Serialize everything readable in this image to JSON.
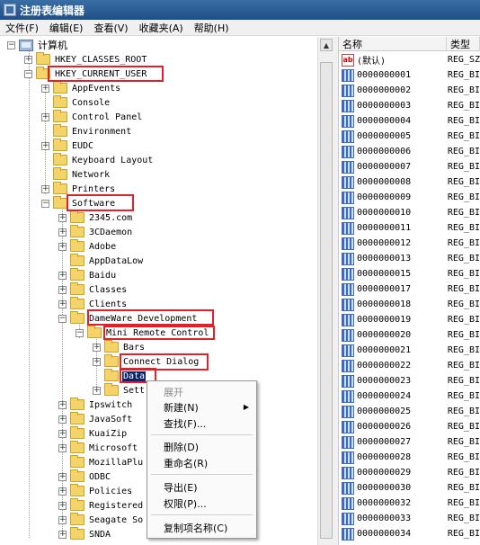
{
  "window": {
    "title": "注册表编辑器"
  },
  "menu": [
    "文件(F)",
    "编辑(E)",
    "查看(V)",
    "收藏夹(A)",
    "帮助(H)"
  ],
  "tree": {
    "root": "计算机",
    "hives": [
      "HKEY_CLASSES_ROOT",
      "HKEY_CURRENT_USER"
    ],
    "hkcu_children": [
      "AppEvents",
      "Console",
      "Control Panel",
      "Environment",
      "EUDC",
      "Keyboard Layout",
      "Network",
      "Printers",
      "Software"
    ],
    "software_children": [
      "2345.com",
      "3CDaemon",
      "Adobe",
      "AppDataLow",
      "Baidu",
      "Classes",
      "Clients",
      "DameWare Development"
    ],
    "dameware_children": [
      "Mini Remote Control"
    ],
    "mrc_children": [
      "Bars",
      "Connect Dialog",
      "Data",
      "Sett"
    ],
    "software_children_2": [
      "Ipswitch",
      "JavaSoft",
      "KuaiZip",
      "Microsoft",
      "MozillaPlu",
      "ODBC",
      "Policies",
      "Registered",
      "Seagate So",
      "SNDA"
    ]
  },
  "list": {
    "headers": [
      "名称",
      "类型"
    ],
    "rows": [
      {
        "name": "(默认)",
        "type": "REG_SZ",
        "icon": "string-value-icon"
      },
      {
        "name": "0000000001",
        "type": "REG_BI",
        "icon": "binary-value-icon"
      },
      {
        "name": "0000000002",
        "type": "REG_BI",
        "icon": "binary-value-icon"
      },
      {
        "name": "0000000003",
        "type": "REG_BI",
        "icon": "binary-value-icon"
      },
      {
        "name": "0000000004",
        "type": "REG_BI",
        "icon": "binary-value-icon"
      },
      {
        "name": "0000000005",
        "type": "REG_BI",
        "icon": "binary-value-icon"
      },
      {
        "name": "0000000006",
        "type": "REG_BI",
        "icon": "binary-value-icon"
      },
      {
        "name": "0000000007",
        "type": "REG_BI",
        "icon": "binary-value-icon"
      },
      {
        "name": "0000000008",
        "type": "REG_BI",
        "icon": "binary-value-icon"
      },
      {
        "name": "0000000009",
        "type": "REG_BI",
        "icon": "binary-value-icon"
      },
      {
        "name": "0000000010",
        "type": "REG_BI",
        "icon": "binary-value-icon"
      },
      {
        "name": "0000000011",
        "type": "REG_BI",
        "icon": "binary-value-icon"
      },
      {
        "name": "0000000012",
        "type": "REG_BI",
        "icon": "binary-value-icon"
      },
      {
        "name": "0000000013",
        "type": "REG_BI",
        "icon": "binary-value-icon"
      },
      {
        "name": "0000000015",
        "type": "REG_BI",
        "icon": "binary-value-icon"
      },
      {
        "name": "0000000017",
        "type": "REG_BI",
        "icon": "binary-value-icon"
      },
      {
        "name": "0000000018",
        "type": "REG_BI",
        "icon": "binary-value-icon"
      },
      {
        "name": "0000000019",
        "type": "REG_BI",
        "icon": "binary-value-icon"
      },
      {
        "name": "0000000020",
        "type": "REG_BI",
        "icon": "binary-value-icon"
      },
      {
        "name": "0000000021",
        "type": "REG_BI",
        "icon": "binary-value-icon"
      },
      {
        "name": "0000000022",
        "type": "REG_BI",
        "icon": "binary-value-icon"
      },
      {
        "name": "0000000023",
        "type": "REG_BI",
        "icon": "binary-value-icon"
      },
      {
        "name": "0000000024",
        "type": "REG_BI",
        "icon": "binary-value-icon"
      },
      {
        "name": "0000000025",
        "type": "REG_BI",
        "icon": "binary-value-icon"
      },
      {
        "name": "0000000026",
        "type": "REG_BI",
        "icon": "binary-value-icon"
      },
      {
        "name": "0000000027",
        "type": "REG_BI",
        "icon": "binary-value-icon"
      },
      {
        "name": "0000000028",
        "type": "REG_BI",
        "icon": "binary-value-icon"
      },
      {
        "name": "0000000029",
        "type": "REG_BI",
        "icon": "binary-value-icon"
      },
      {
        "name": "0000000030",
        "type": "REG_BI",
        "icon": "binary-value-icon"
      },
      {
        "name": "0000000032",
        "type": "REG_BI",
        "icon": "binary-value-icon"
      },
      {
        "name": "0000000033",
        "type": "REG_BI",
        "icon": "binary-value-icon"
      },
      {
        "name": "0000000034",
        "type": "REG_BI",
        "icon": "binary-value-icon"
      }
    ]
  },
  "context_menu": {
    "expand": "展开",
    "new": "新建(N)",
    "find": "查找(F)...",
    "delete": "删除(D)",
    "rename": "重命名(R)",
    "export": "导出(E)",
    "permissions": "权限(P)...",
    "copy_key_name": "复制项名称(C)"
  },
  "colors": {
    "annotation": "#e0202a",
    "selection": "#0a246a"
  }
}
